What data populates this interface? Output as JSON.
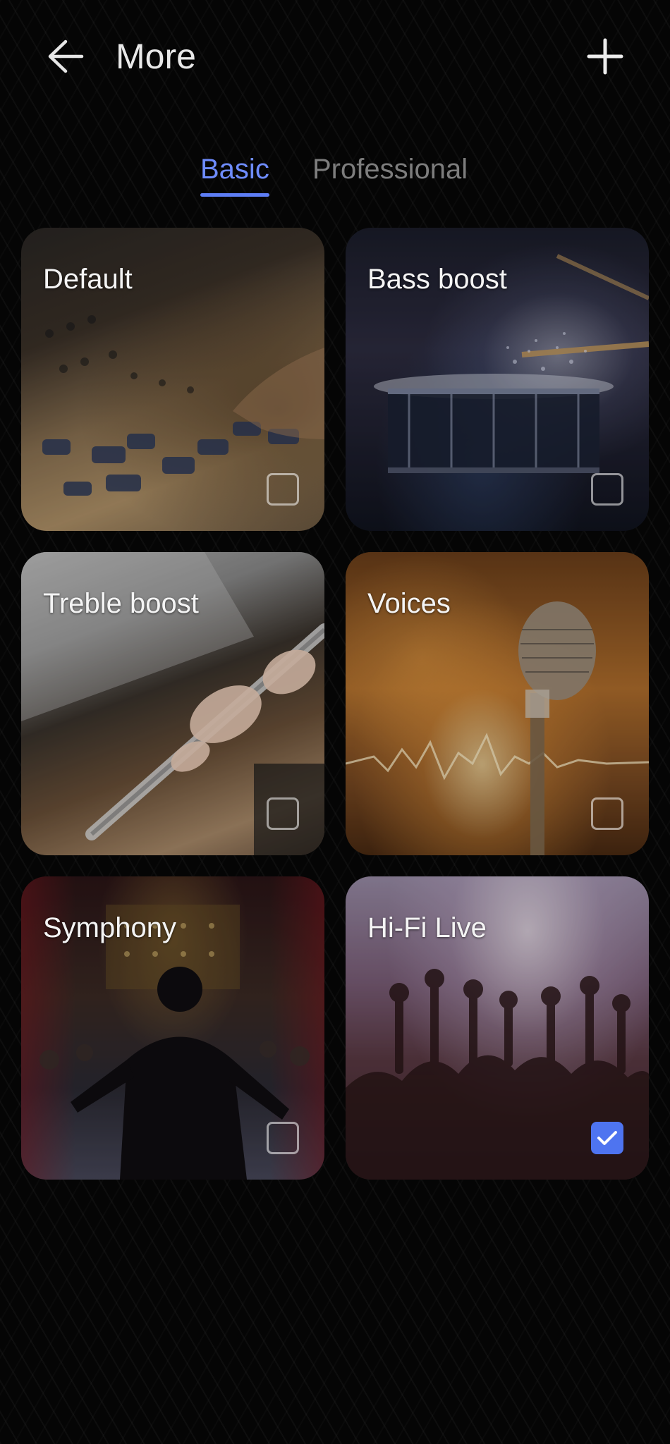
{
  "header": {
    "title": "More",
    "back_icon": "arrow-left-icon",
    "add_icon": "plus-icon"
  },
  "tabs": [
    {
      "label": "Basic",
      "selected": true
    },
    {
      "label": "Professional",
      "selected": false
    }
  ],
  "presets": [
    {
      "label": "Default",
      "checked": false
    },
    {
      "label": "Bass boost",
      "checked": false
    },
    {
      "label": "Treble boost",
      "checked": false
    },
    {
      "label": "Voices",
      "checked": false
    },
    {
      "label": "Symphony",
      "checked": false
    },
    {
      "label": "Hi-Fi Live",
      "checked": true
    }
  ],
  "colors": {
    "accent": "#5d7df5",
    "checkbox_checked": "#4e74f0",
    "tab_inactive": "#7d7d7d",
    "background": "#050505"
  }
}
